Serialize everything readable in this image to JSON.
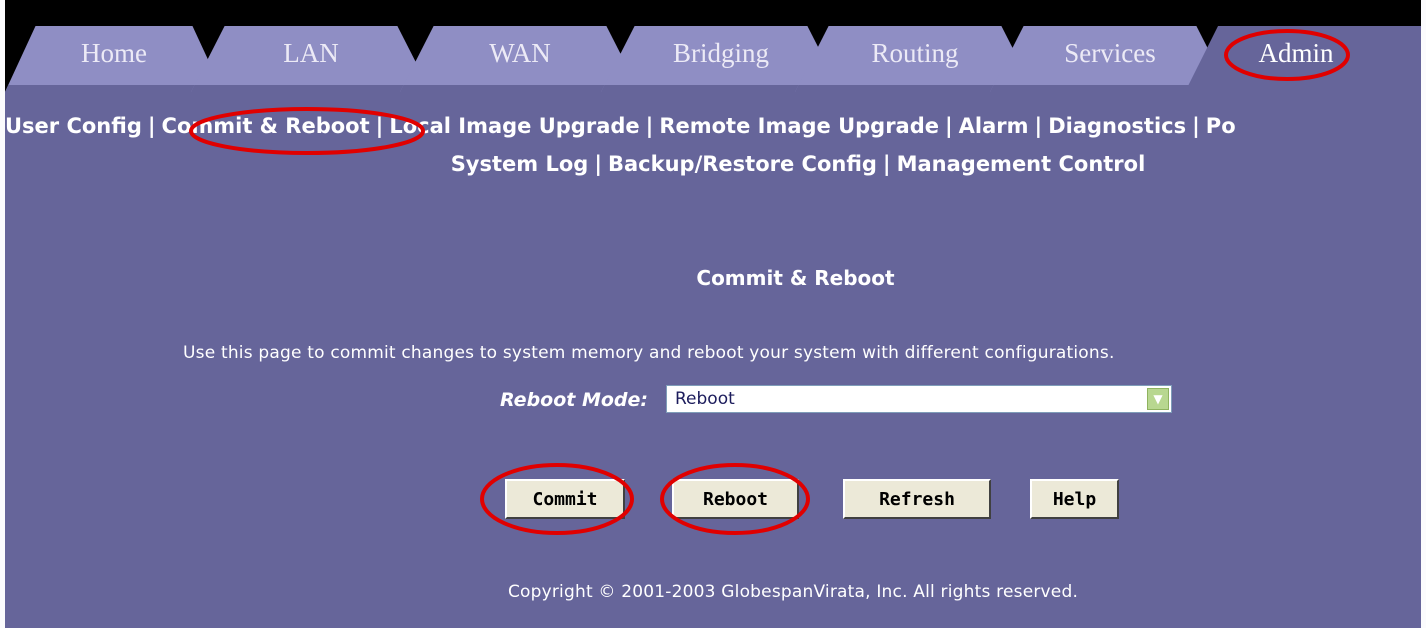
{
  "tabs": [
    {
      "label": "Home"
    },
    {
      "label": "LAN"
    },
    {
      "label": "WAN"
    },
    {
      "label": "Bridging"
    },
    {
      "label": "Routing"
    },
    {
      "label": "Services"
    },
    {
      "label": "Admin",
      "active": true
    }
  ],
  "subnav": {
    "row1": [
      "User Config",
      "Commit & Reboot",
      "Local Image Upgrade",
      "Remote Image Upgrade",
      "Alarm",
      "Diagnostics",
      "Po"
    ],
    "row2": [
      "System Log",
      "Backup/Restore Config",
      "Management Control"
    ]
  },
  "page": {
    "title": "Commit & Reboot",
    "description": "Use this page to commit changes to system memory and reboot your system with different configurations."
  },
  "form": {
    "reboot_mode_label": "Reboot Mode:",
    "reboot_mode_value": "Reboot"
  },
  "buttons": {
    "commit": "Commit",
    "reboot": "Reboot",
    "refresh": "Refresh",
    "help": "Help"
  },
  "footer": {
    "copyright": "Copyright © 2001-2003 GlobespanVirata, Inc. All rights reserved."
  },
  "colors": {
    "page_background": "#66659a",
    "tab_background": "#8f8ec4",
    "tab_strip": "#000000",
    "annotation_highlight": "#e00000"
  }
}
